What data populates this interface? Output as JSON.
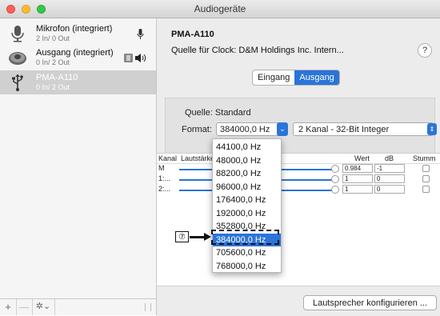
{
  "window": {
    "title": "Audiogeräte"
  },
  "sidebar": {
    "devices": [
      {
        "name": "Mikrofon (integriert)",
        "sub": "2 In/ 0 Out",
        "icon": "microphone-icon",
        "badge": "microphone-badge-icon"
      },
      {
        "name": "Ausgang (integriert)",
        "sub": "0 In/ 2 Out",
        "icon": "speaker-icon",
        "badge": "speaker-badge-icon"
      },
      {
        "name": "PMA-A110",
        "sub": "0 In/ 2 Out",
        "icon": "usb-icon",
        "selected": true
      }
    ],
    "footer": {
      "add": "+",
      "remove": "—",
      "gear": "✲⌄"
    }
  },
  "main": {
    "device_title": "PMA-A110",
    "clock_label": "Quelle für Clock:",
    "clock_value": "D&M Holdings Inc. Intern...",
    "help": "?",
    "tabs": [
      {
        "label": "Eingang"
      },
      {
        "label": "Ausgang",
        "active": true
      }
    ],
    "source_label": "Quelle:",
    "source_value": "Standard",
    "format_label": "Format:",
    "format_value": "384000,0 Hz",
    "channels_value": "2 Kanal - 32-Bit Integer",
    "table": {
      "headers": {
        "kanal": "Kanal",
        "lautstaerke": "Lautstärke",
        "wert": "Wert",
        "db": "dB",
        "stumm": "Stumm"
      },
      "rows": [
        {
          "label": "M",
          "wert": "0.984",
          "db": "-1"
        },
        {
          "label": "1:...",
          "wert": "1",
          "db": "0"
        },
        {
          "label": "2:...",
          "wert": "1",
          "db": "0"
        }
      ]
    },
    "configure_button": "Lautsprecher konfigurieren ..."
  },
  "dropdown": {
    "options": [
      "44100,0 Hz",
      "48000,0 Hz",
      "88200,0 Hz",
      "96000,0 Hz",
      "176400,0 Hz",
      "192000,0 Hz",
      "352800,0 Hz",
      "384000,0 Hz",
      "705600,0 Hz",
      "768000,0 Hz"
    ],
    "selected_index": 7
  },
  "annotation": {
    "callout": "⑦"
  },
  "colors": {
    "accent": "#2b74d9",
    "close": "#fc5f57",
    "minimize": "#fdbc2e",
    "zoom": "#34c84a"
  }
}
